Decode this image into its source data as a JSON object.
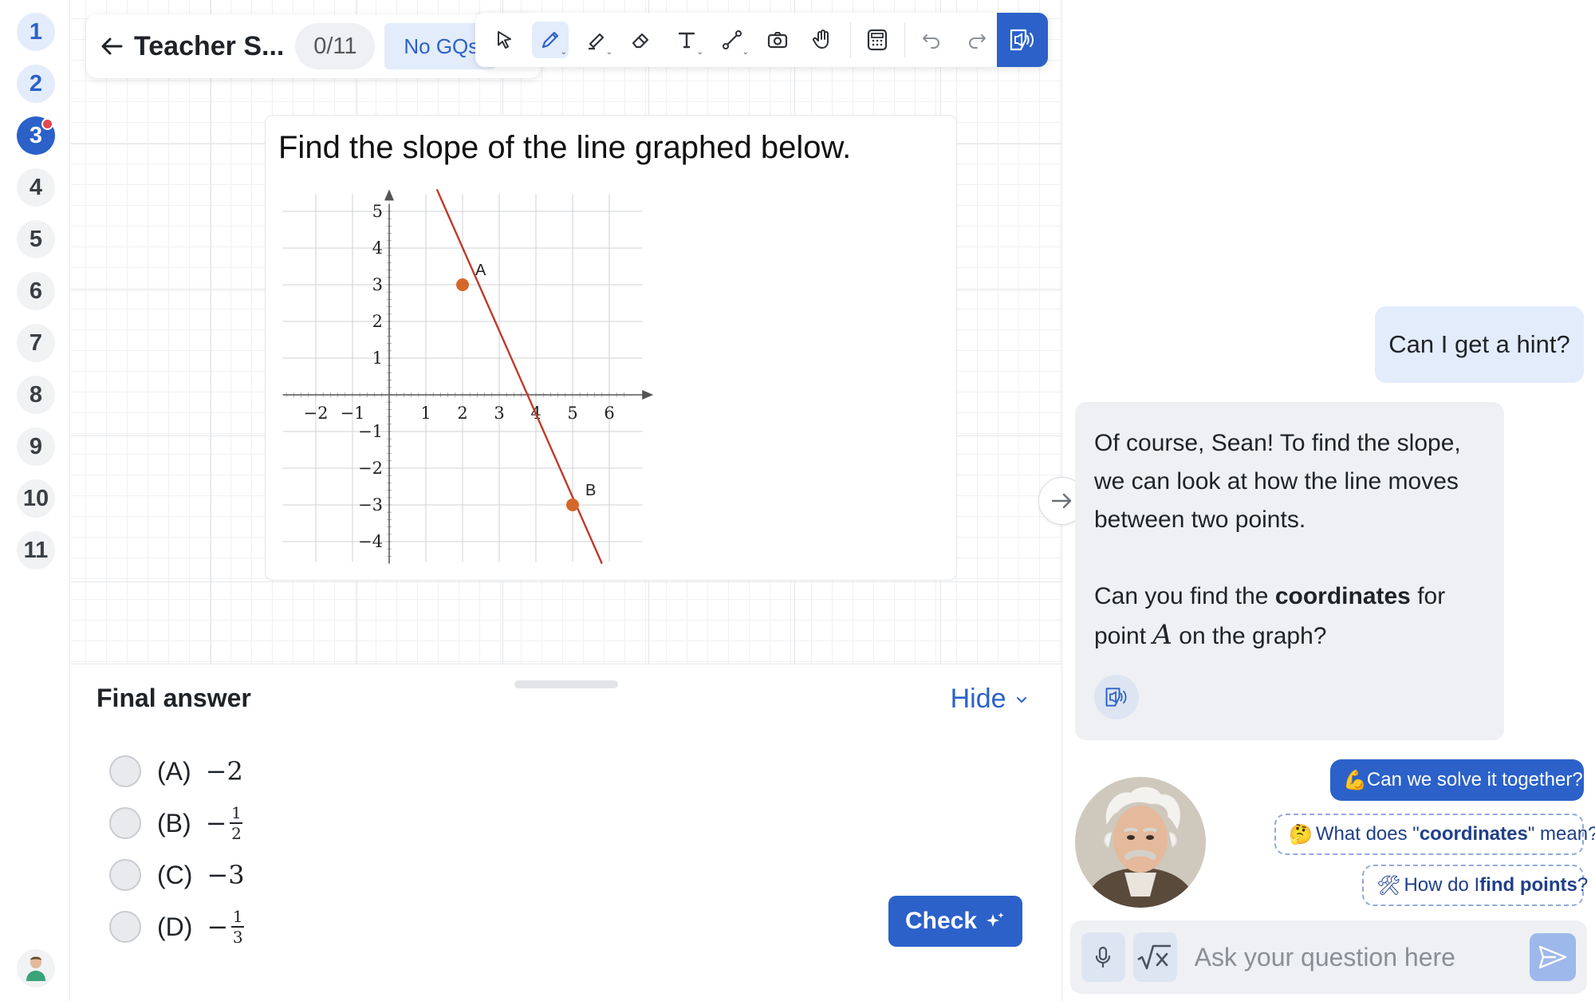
{
  "sidebar": {
    "questions": [
      {
        "label": "1",
        "state": "done"
      },
      {
        "label": "2",
        "state": "done"
      },
      {
        "label": "3",
        "state": "active"
      },
      {
        "label": "4",
        "state": "todo"
      },
      {
        "label": "5",
        "state": "todo"
      },
      {
        "label": "6",
        "state": "todo"
      },
      {
        "label": "7",
        "state": "todo"
      },
      {
        "label": "8",
        "state": "todo"
      },
      {
        "label": "9",
        "state": "todo"
      },
      {
        "label": "10",
        "state": "todo"
      },
      {
        "label": "11",
        "state": "todo"
      }
    ]
  },
  "header": {
    "title": "Teacher S...",
    "progress": "0/11",
    "gq_label": "No GQs"
  },
  "toolbar": {
    "tools": [
      "select-tool",
      "pen-tool",
      "highlighter-tool",
      "eraser-tool",
      "text-tool",
      "line-tool",
      "camera-tool",
      "hand-tool",
      "calculator-tool",
      "undo",
      "redo",
      "read-aloud"
    ]
  },
  "question": {
    "text": "Find the slope of the line graphed below."
  },
  "chart_data": {
    "type": "line",
    "x_ticks": [
      "−2",
      "−1",
      "1",
      "2",
      "3",
      "4",
      "5",
      "6"
    ],
    "y_ticks": [
      "5",
      "4",
      "3",
      "2",
      "1",
      "−1",
      "−2",
      "−3",
      "−4"
    ],
    "xlim": [
      -3,
      7
    ],
    "ylim": [
      -4.6,
      5.6
    ],
    "grid": true,
    "line": {
      "x": [
        1.3,
        5.8
      ],
      "y": [
        5.6,
        -4.6
      ],
      "color": "#c0392b"
    },
    "points": [
      {
        "name": "A",
        "x": 2,
        "y": 3
      },
      {
        "name": "B",
        "x": 5,
        "y": -3
      }
    ]
  },
  "answer": {
    "title": "Final answer",
    "hide_label": "Hide",
    "choices": [
      {
        "label": "(A)",
        "value": "−2"
      },
      {
        "label": "(B)",
        "value": "−",
        "num": "1",
        "den": "2"
      },
      {
        "label": "(C)",
        "value": "−3"
      },
      {
        "label": "(D)",
        "value": "−",
        "num": "1",
        "den": "3"
      }
    ],
    "check_label": "Check"
  },
  "chat": {
    "user_message": "Can I get a hint?",
    "bot_line1": "Of course, Sean! To find the slope, we can look at how the line moves between two points.",
    "bot_line2_pre": "Can you find the ",
    "bot_line2_bold": "coordinates",
    "bot_line2_post": " for",
    "bot_line3_pre": "point ",
    "bot_line3_var": "A",
    "bot_line3_post": " on the graph?",
    "suggestions": [
      {
        "emoji": "💪",
        "pre": "Can we solve it together?",
        "bold": "",
        "post": ""
      },
      {
        "emoji": "🤔",
        "pre": "What does \"",
        "bold": "coordinates",
        "post": "\" mean?"
      },
      {
        "emoji": "🛠",
        "pre": "How do I ",
        "bold": "find points",
        "post": "?"
      }
    ],
    "input_placeholder": "Ask your question here"
  }
}
